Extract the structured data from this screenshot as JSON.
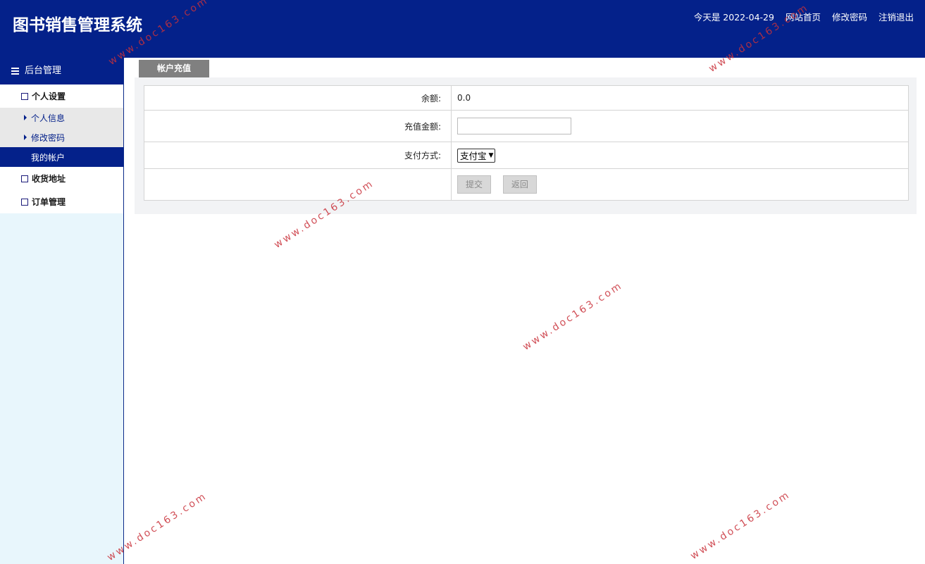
{
  "app": {
    "title": "图书销售管理系统"
  },
  "header": {
    "date_text": "今天是 2022-04-29",
    "links": [
      "网站首页",
      "修改密码",
      "注销退出"
    ]
  },
  "sidebar": {
    "title": "后台管理",
    "groups": [
      {
        "label": "个人设置",
        "items": [
          "个人信息",
          "修改密码",
          "我的帐户"
        ]
      },
      {
        "label": "收货地址"
      },
      {
        "label": "订单管理"
      }
    ]
  },
  "main": {
    "tab": "帐户充值",
    "form": {
      "balance_label": "余额:",
      "balance_value": "0.0",
      "amount_label": "充值金额:",
      "amount_value": "",
      "pay_label": "支付方式:",
      "pay_selected": "支付宝",
      "submit_label": "提交",
      "back_label": "返回"
    }
  },
  "watermark": "www.doc163.com",
  "colors": {
    "header_bg": "#04218a",
    "sidebar_bg": "#e8f6fc",
    "tab_bg": "#808080",
    "watermark": "#c9313a"
  }
}
